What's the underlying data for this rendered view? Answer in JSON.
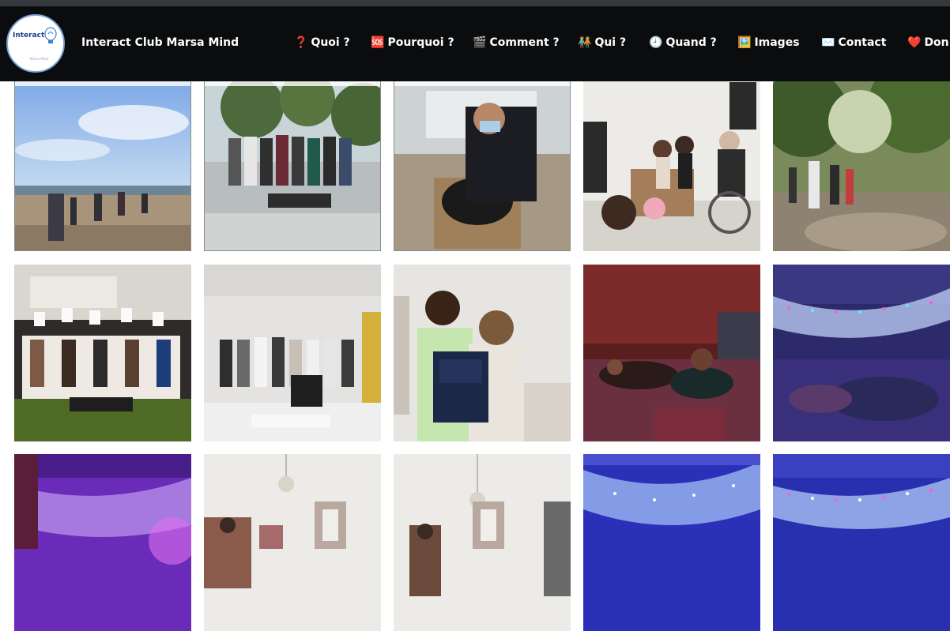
{
  "header": {
    "brand": "Interact Club Marsa Mind",
    "logo": {
      "word": "Interact",
      "tagline": "Marsa Mind"
    },
    "nav": [
      {
        "icon": "❓",
        "icon_name": "question-icon",
        "label": "Quoi ?"
      },
      {
        "icon": "🆘",
        "icon_name": "sos-icon",
        "label": "Pourquoi ?"
      },
      {
        "icon": "🎬",
        "icon_name": "clapperboard-icon",
        "label": "Comment ?"
      },
      {
        "icon": "🧑‍🤝‍🧑",
        "icon_name": "people-icon",
        "label": "Qui ?"
      },
      {
        "icon": "🕘",
        "icon_name": "clock-icon",
        "label": "Quand ?"
      },
      {
        "icon": "🖼️",
        "icon_name": "framed-picture-icon",
        "label": "Images"
      },
      {
        "icon": "✉️",
        "icon_name": "envelope-icon",
        "label": "Contact"
      },
      {
        "icon": "❤️",
        "icon_name": "heart-icon",
        "label": "Don"
      }
    ]
  },
  "gallery": {
    "photos": [
      {
        "name": "photo-beach-walk",
        "scene": "beach"
      },
      {
        "name": "photo-group-outdoors",
        "scene": "group-park"
      },
      {
        "name": "photo-trash-bag-box",
        "scene": "box"
      },
      {
        "name": "photo-elderly-visit",
        "scene": "visit"
      },
      {
        "name": "photo-forest-cleanup",
        "scene": "forest"
      },
      {
        "name": "photo-certificates-group",
        "scene": "certificates"
      },
      {
        "name": "photo-conference-group",
        "scene": "conference"
      },
      {
        "name": "photo-backpack-gift",
        "scene": "backpack"
      },
      {
        "name": "photo-red-room",
        "scene": "redroom"
      },
      {
        "name": "photo-light-room",
        "scene": "lightroom"
      },
      {
        "name": "photo-purple-lights",
        "scene": "purple"
      },
      {
        "name": "photo-chandelier-room",
        "scene": "chandelier"
      },
      {
        "name": "photo-chandelier-room-2",
        "scene": "chandelier"
      },
      {
        "name": "photo-blue-lights",
        "scene": "bluelights"
      },
      {
        "name": "photo-blue-lights-2",
        "scene": "bluelights"
      }
    ]
  },
  "colors": {
    "header_bg": "#0b0c0e",
    "top_strip": "#35383d",
    "text": "#ffffff"
  }
}
